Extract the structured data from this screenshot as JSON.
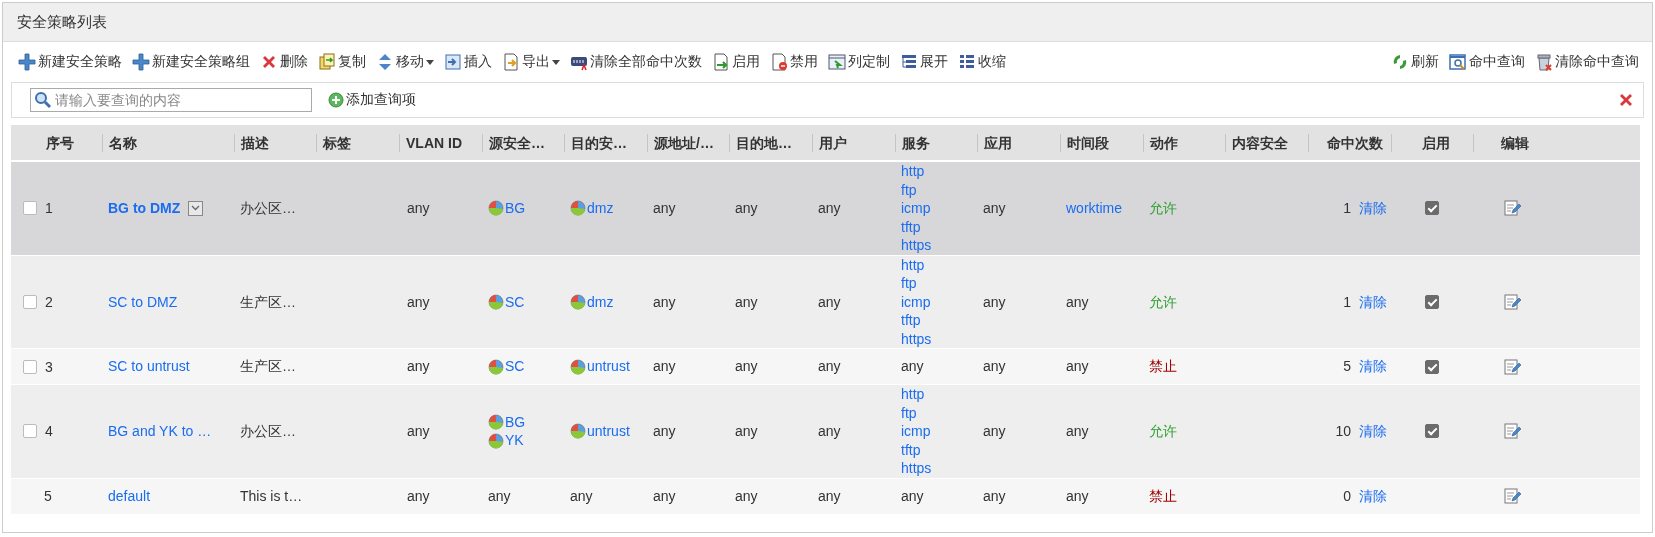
{
  "panel": {
    "title": "安全策略列表"
  },
  "toolbar": {
    "left": [
      {
        "label": "新建安全策略",
        "dropdown": false
      },
      {
        "label": "新建安全策略组",
        "dropdown": false
      },
      {
        "label": "删除",
        "dropdown": false
      },
      {
        "label": "复制",
        "dropdown": false
      },
      {
        "label": "移动",
        "dropdown": true
      },
      {
        "label": "插入",
        "dropdown": false
      },
      {
        "label": "导出",
        "dropdown": true
      },
      {
        "label": "清除全部命中次数",
        "dropdown": false
      },
      {
        "label": "启用",
        "dropdown": false
      },
      {
        "label": "禁用",
        "dropdown": false
      },
      {
        "label": "列定制",
        "dropdown": false
      },
      {
        "label": "展开",
        "dropdown": false
      },
      {
        "label": "收缩",
        "dropdown": false
      }
    ],
    "right": [
      {
        "label": "刷新",
        "dropdown": false
      },
      {
        "label": "命中查询",
        "dropdown": false
      },
      {
        "label": "清除命中查询",
        "dropdown": false
      }
    ]
  },
  "search": {
    "placeholder": "请输入要查询的内容",
    "add_label": "添加查询项"
  },
  "table": {
    "columns": [
      "序号",
      "名称",
      "描述",
      "标签",
      "VLAN ID",
      "源安全…",
      "目的安…",
      "源地址/…",
      "目的地…",
      "用户",
      "服务",
      "应用",
      "时间段",
      "动作",
      "内容安全",
      "命中次数",
      "启用",
      "编辑"
    ],
    "rows": [
      {
        "number": "1",
        "selected": true,
        "checked": false,
        "name": "BG to DMZ",
        "description": "办公区…",
        "vlan_id": "any",
        "source_zone": [
          {
            "text": "BG",
            "kind": "zone"
          }
        ],
        "destination_zone": [
          {
            "text": "dmz",
            "kind": "zone"
          }
        ],
        "source_address": [
          {
            "text": "any",
            "kind": "plain"
          }
        ],
        "destination_address": [
          {
            "text": "any",
            "kind": "plain"
          }
        ],
        "user": [
          {
            "text": "any",
            "kind": "plain"
          }
        ],
        "service": [
          {
            "text": "http",
            "kind": "link"
          },
          {
            "text": "ftp",
            "kind": "link"
          },
          {
            "text": "icmp",
            "kind": "link"
          },
          {
            "text": "tftp",
            "kind": "link"
          },
          {
            "text": "https",
            "kind": "link"
          }
        ],
        "application": [
          {
            "text": "any",
            "kind": "plain"
          }
        ],
        "schedule": [
          {
            "text": "worktime",
            "kind": "link"
          }
        ],
        "action": {
          "text": "允许",
          "kind": "allow"
        },
        "hits": "1",
        "clear": "清除",
        "enabled": true
      },
      {
        "number": "2",
        "selected": false,
        "checked": false,
        "name": "SC to DMZ",
        "description": "生产区…",
        "vlan_id": "any",
        "source_zone": [
          {
            "text": "SC",
            "kind": "zone"
          }
        ],
        "destination_zone": [
          {
            "text": "dmz",
            "kind": "zone"
          }
        ],
        "source_address": [
          {
            "text": "any",
            "kind": "plain"
          }
        ],
        "destination_address": [
          {
            "text": "any",
            "kind": "plain"
          }
        ],
        "user": [
          {
            "text": "any",
            "kind": "plain"
          }
        ],
        "service": [
          {
            "text": "http",
            "kind": "link"
          },
          {
            "text": "ftp",
            "kind": "link"
          },
          {
            "text": "icmp",
            "kind": "link"
          },
          {
            "text": "tftp",
            "kind": "link"
          },
          {
            "text": "https",
            "kind": "link"
          }
        ],
        "application": [
          {
            "text": "any",
            "kind": "plain"
          }
        ],
        "schedule": [
          {
            "text": "any",
            "kind": "plain"
          }
        ],
        "action": {
          "text": "允许",
          "kind": "allow"
        },
        "hits": "1",
        "clear": "清除",
        "enabled": true
      },
      {
        "number": "3",
        "selected": false,
        "checked": false,
        "name": "SC to untrust",
        "description": "生产区…",
        "vlan_id": "any",
        "source_zone": [
          {
            "text": "SC",
            "kind": "zone"
          }
        ],
        "destination_zone": [
          {
            "text": "untrust",
            "kind": "zone"
          }
        ],
        "source_address": [
          {
            "text": "any",
            "kind": "plain"
          }
        ],
        "destination_address": [
          {
            "text": "any",
            "kind": "plain"
          }
        ],
        "user": [
          {
            "text": "any",
            "kind": "plain"
          }
        ],
        "service": [
          {
            "text": "any",
            "kind": "plain"
          }
        ],
        "application": [
          {
            "text": "any",
            "kind": "plain"
          }
        ],
        "schedule": [
          {
            "text": "any",
            "kind": "plain"
          }
        ],
        "action": {
          "text": "禁止",
          "kind": "deny"
        },
        "hits": "5",
        "clear": "清除",
        "enabled": true
      },
      {
        "number": "4",
        "selected": false,
        "checked": false,
        "name": "BG and YK to …",
        "description": "办公区…",
        "vlan_id": "any",
        "source_zone": [
          {
            "text": "BG",
            "kind": "zone"
          },
          {
            "text": "YK",
            "kind": "zone"
          }
        ],
        "destination_zone": [
          {
            "text": "untrust",
            "kind": "zone"
          }
        ],
        "source_address": [
          {
            "text": "any",
            "kind": "plain"
          }
        ],
        "destination_address": [
          {
            "text": "any",
            "kind": "plain"
          }
        ],
        "user": [
          {
            "text": "any",
            "kind": "plain"
          }
        ],
        "service": [
          {
            "text": "http",
            "kind": "link"
          },
          {
            "text": "ftp",
            "kind": "link"
          },
          {
            "text": "icmp",
            "kind": "link"
          },
          {
            "text": "tftp",
            "kind": "link"
          },
          {
            "text": "https",
            "kind": "link"
          }
        ],
        "application": [
          {
            "text": "any",
            "kind": "plain"
          }
        ],
        "schedule": [
          {
            "text": "any",
            "kind": "plain"
          }
        ],
        "action": {
          "text": "允许",
          "kind": "allow"
        },
        "hits": "10",
        "clear": "清除",
        "enabled": true
      },
      {
        "number": "5",
        "selected": false,
        "name": "default",
        "description": "This is t…",
        "vlan_id": "any",
        "source_zone": [
          {
            "text": "any",
            "kind": "plain"
          }
        ],
        "destination_zone": [
          {
            "text": "any",
            "kind": "plain"
          }
        ],
        "source_address": [
          {
            "text": "any",
            "kind": "plain"
          }
        ],
        "destination_address": [
          {
            "text": "any",
            "kind": "plain"
          }
        ],
        "user": [
          {
            "text": "any",
            "kind": "plain"
          }
        ],
        "service": [
          {
            "text": "any",
            "kind": "plain"
          }
        ],
        "application": [
          {
            "text": "any",
            "kind": "plain"
          }
        ],
        "schedule": [
          {
            "text": "any",
            "kind": "plain"
          }
        ],
        "action": {
          "text": "禁止",
          "kind": "deny"
        },
        "hits": "0",
        "clear": "清除"
      }
    ]
  }
}
